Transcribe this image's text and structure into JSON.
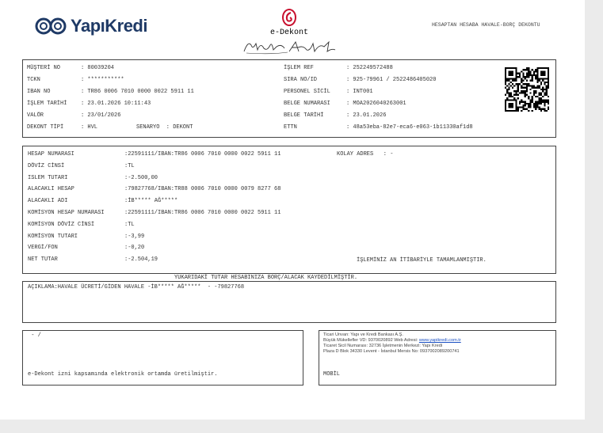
{
  "brand": {
    "name": "YapıKredi"
  },
  "header": {
    "title": "e-Dekont",
    "right_text": "HESAPTAN HESABA HAVALE-BORÇ DEKONTU"
  },
  "customer": {
    "left": [
      {
        "label": "MÜŞTERİ NO",
        "value": ": 80039204"
      },
      {
        "label": "TCKN",
        "value": ": ***********"
      },
      {
        "label": "IBAN NO",
        "value": ": TR86 0006 7010 0000 0022 5911 11"
      },
      {
        "label": "İŞLEM TARİHİ",
        "value": ": 23.01.2026 10:11:43"
      },
      {
        "label": "VALÖR",
        "value": ": 23/01/2026"
      },
      {
        "label": "DEKONT TİPİ",
        "value": ": HVL"
      }
    ],
    "senaryo": "SENARYO  : DEKONT",
    "right": [
      {
        "label": "İŞLEM REF",
        "value": ": 252249572488"
      },
      {
        "label": "SIRA NO/ID",
        "value": ": 925-79961 / 2522486405020"
      },
      {
        "label": "PERSONEL SİCİL",
        "value": ": INT001"
      },
      {
        "label": "BELGE NUMARASI",
        "value": ": MOA2026040263001"
      },
      {
        "label": "BELGE TARİHİ",
        "value": ": 23.01.2026"
      },
      {
        "label": "ETTN",
        "value": ": 48a53eba-82e7-eca6-e063-1b11330af1d8"
      }
    ]
  },
  "details": [
    {
      "label": "HESAP NUMARASI",
      "value": ":22591111/IBAN:TR86 0006 7010 0000 0022 5911 11"
    },
    {
      "label": "DÖVİZ CİNSİ",
      "value": ":TL"
    },
    {
      "label": "ISLEM TUTARI",
      "value": ":-2.500,00"
    },
    {
      "label": "ALACAKLI HESAP",
      "value": ":79827768/IBAN:TR88 0006 7010 0000 0079 8277 68"
    },
    {
      "label": "ALACAKLI ADI",
      "value": ":İB***** AĞ*****"
    },
    {
      "label": "KOMİSYON HESAP NUMARASI",
      "value": ":22591111/IBAN:TR86 0006 7010 0000 0022 5911 11"
    },
    {
      "label": "KOMİSYON DÖVİZ CİNSİ",
      "value": ":TL"
    },
    {
      "label": "KOMİSYON TUTARI",
      "value": ":-3,99"
    },
    {
      "label": "VERGİ/FON",
      "value": ":-0,20"
    },
    {
      "label": "NET TUTAR",
      "value": ":-2.504,19"
    }
  ],
  "kolay_adres": "KOLAY ADRES   : -",
  "completed_text": "İŞLEMİNİZ AN İTİBARİYLE TAMAMLANMIŞTIR.",
  "notice": "YUKARIDAKİ TUTAR HESABINIZA BORÇ/ALACAK KAYDEDİLMİŞTİR.",
  "aciklama": "AÇIKLAMA:HAVALE ÜCRETİ/GİDEN HAVALE -İB***** AĞ*****  - -79827768",
  "footer_left": {
    "top": " - /",
    "bottom": "e-Dekont izni kapsamında elektronik ortamda üretilmiştir."
  },
  "footer_right": {
    "line1": "Ticari Unvan: Yapı ve Kredi Bankası A.Ş.",
    "line2_prefix": "Büyük Mükellefler VD: 9370020892 Web Adresi: ",
    "line2_link": "www.yapikredi.com.tr",
    "line3": "Ticaret Sicil Numarası: 32736 İşletmenin Merkezi: Yapı Kredi",
    "line4": "Plaza D Blok 34330 Levent - İstanbul Mersis No: 0937002089200741",
    "channel": "MOBİL"
  },
  "colors": {
    "brand_blue": "#1f3a66",
    "stamp_red": "#c8102e"
  }
}
